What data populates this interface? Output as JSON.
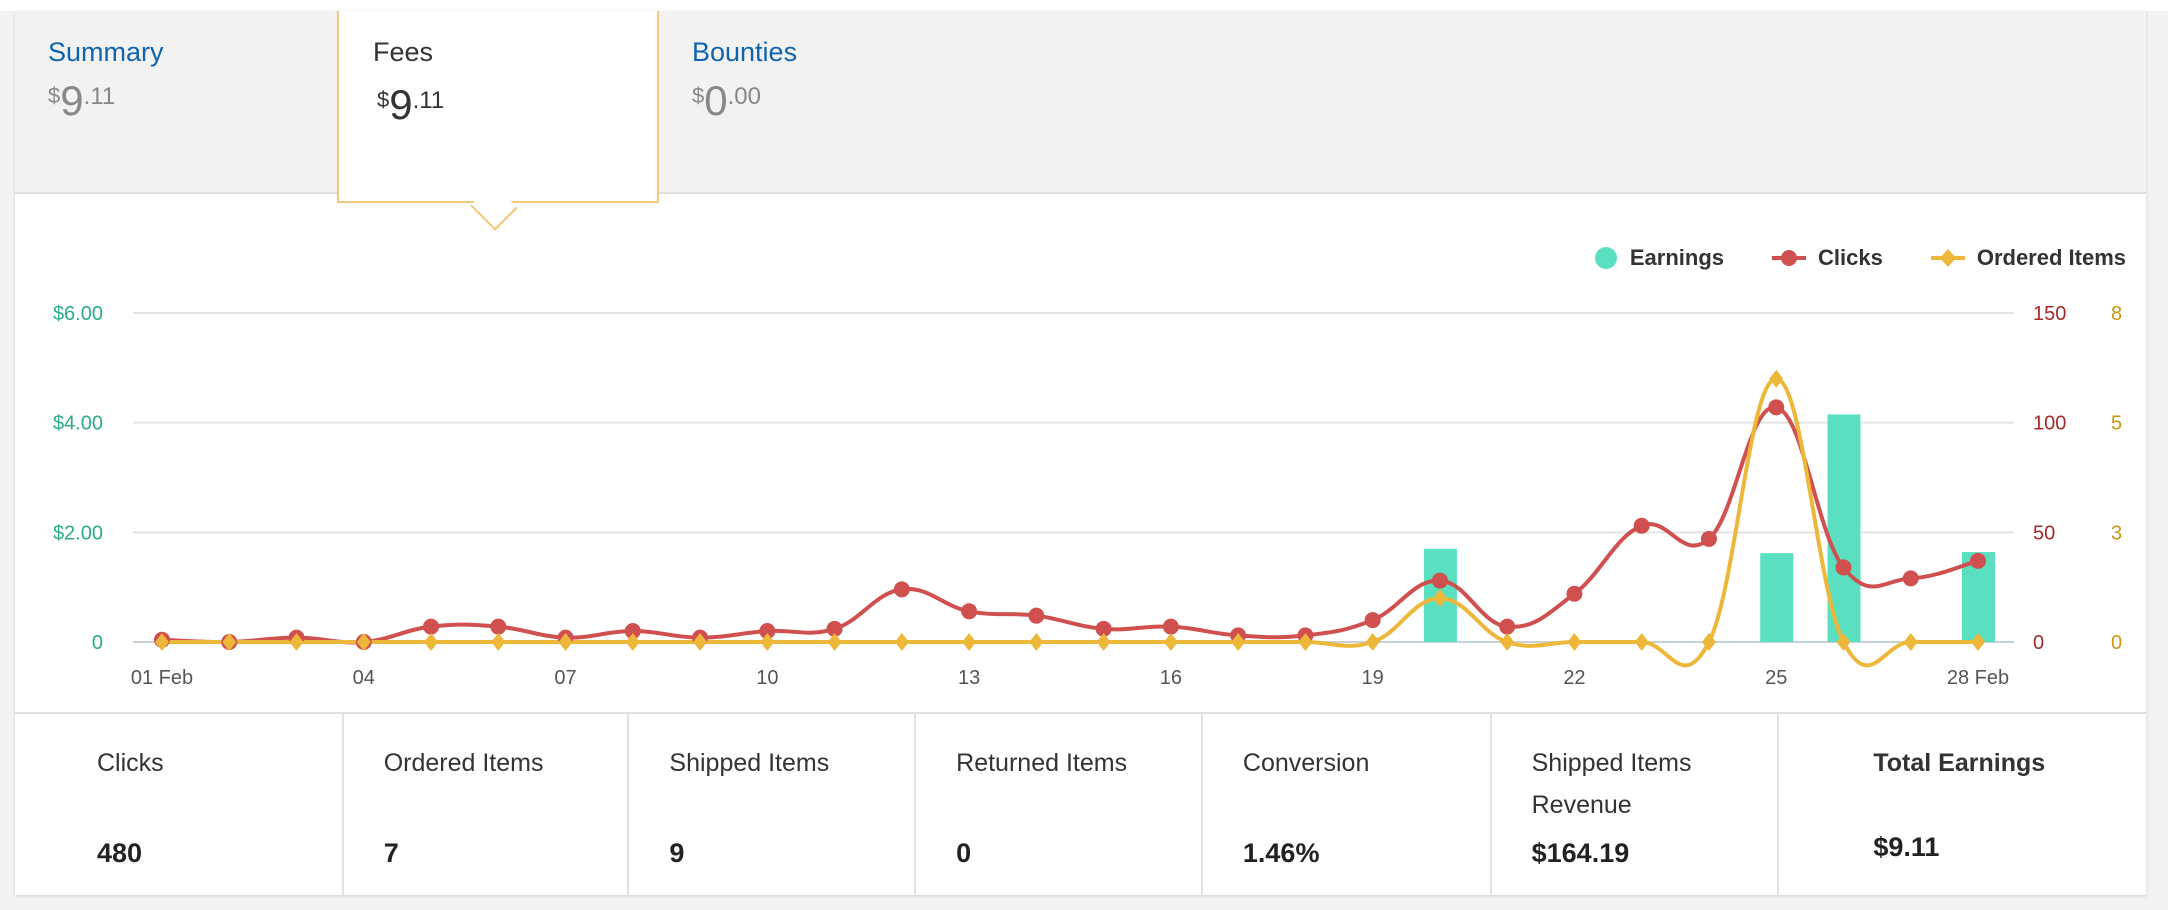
{
  "tabs": [
    {
      "label": "Summary",
      "currency": "$",
      "whole": "9",
      "cents": ".11",
      "active": false
    },
    {
      "label": "Fees",
      "currency": "$",
      "whole": "9",
      "cents": ".11",
      "active": true
    },
    {
      "label": "Bounties",
      "currency": "$",
      "whole": "0",
      "cents": ".00",
      "active": false
    }
  ],
  "colors": {
    "earnings": "#5ae0c1",
    "clicks": "#d04f4f",
    "ordered_items": "#edb73a",
    "left_axis": "#2aab8a",
    "clicks_axis": "#a52a2a",
    "items_axis": "#c9960e",
    "link": "#0f64ad"
  },
  "legend": {
    "earnings": "Earnings",
    "clicks": "Clicks",
    "ordered_items": "Ordered Items"
  },
  "chart_data": {
    "type": "bar+line",
    "x": [
      "01",
      "02",
      "03",
      "04",
      "05",
      "06",
      "07",
      "08",
      "09",
      "10",
      "11",
      "12",
      "13",
      "14",
      "15",
      "16",
      "17",
      "18",
      "19",
      "20",
      "21",
      "22",
      "23",
      "24",
      "25",
      "26",
      "27",
      "28"
    ],
    "x_tick_labels": [
      "01 Feb",
      "04",
      "07",
      "10",
      "13",
      "16",
      "19",
      "22",
      "25",
      "28 Feb"
    ],
    "x_tick_days": [
      "01",
      "04",
      "07",
      "10",
      "13",
      "16",
      "19",
      "22",
      "25",
      "28"
    ],
    "series": [
      {
        "name": "Earnings",
        "type": "bar",
        "axis": "left",
        "values": [
          0,
          0,
          0,
          0,
          0,
          0,
          0,
          0,
          0,
          0,
          0,
          0,
          0,
          0,
          0,
          0,
          0,
          0,
          0,
          1.7,
          0,
          0,
          0,
          0,
          1.62,
          4.15,
          0,
          1.64
        ]
      },
      {
        "name": "Clicks",
        "type": "line",
        "axis": "right1",
        "values": [
          1,
          0,
          2,
          0,
          7,
          7,
          2,
          5,
          2,
          5,
          6,
          24,
          14,
          12,
          6,
          7,
          3,
          3,
          10,
          28,
          7,
          22,
          53,
          47,
          107,
          34,
          29,
          37
        ]
      },
      {
        "name": "Ordered Items",
        "type": "line",
        "axis": "right2",
        "values": [
          0,
          0,
          0,
          0,
          0,
          0,
          0,
          0,
          0,
          0,
          0,
          0,
          0,
          0,
          0,
          0,
          0,
          0,
          0,
          1,
          0,
          0,
          0,
          0,
          6,
          0,
          0,
          0
        ]
      }
    ],
    "left_axis": {
      "ylim": [
        0,
        6
      ],
      "ticks": [
        0,
        2,
        4,
        6
      ],
      "tick_labels": [
        "0",
        "$2.00",
        "$4.00",
        "$6.00"
      ]
    },
    "right_axis_clicks": {
      "ylim": [
        0,
        150
      ],
      "ticks": [
        0,
        50,
        100,
        150
      ],
      "tick_labels": [
        "0",
        "50",
        "100",
        "150"
      ]
    },
    "right_axis_items": {
      "ylim": [
        0,
        7.5
      ],
      "ticks": [
        0,
        2.5,
        5,
        7.5
      ],
      "tick_labels": [
        "0",
        "3",
        "5",
        "8"
      ]
    },
    "grid": true,
    "legend_position": "top-right"
  },
  "stats": [
    {
      "label": "Clicks",
      "value": "480"
    },
    {
      "label": "Ordered Items",
      "value": "7"
    },
    {
      "label": "Shipped Items",
      "value": "9"
    },
    {
      "label": "Returned Items",
      "value": "0"
    },
    {
      "label": "Conversion",
      "value": "1.46%"
    },
    {
      "label": "Shipped Items Revenue",
      "value": "$164.19"
    },
    {
      "label": "Total Earnings",
      "value": "$9.11"
    }
  ]
}
